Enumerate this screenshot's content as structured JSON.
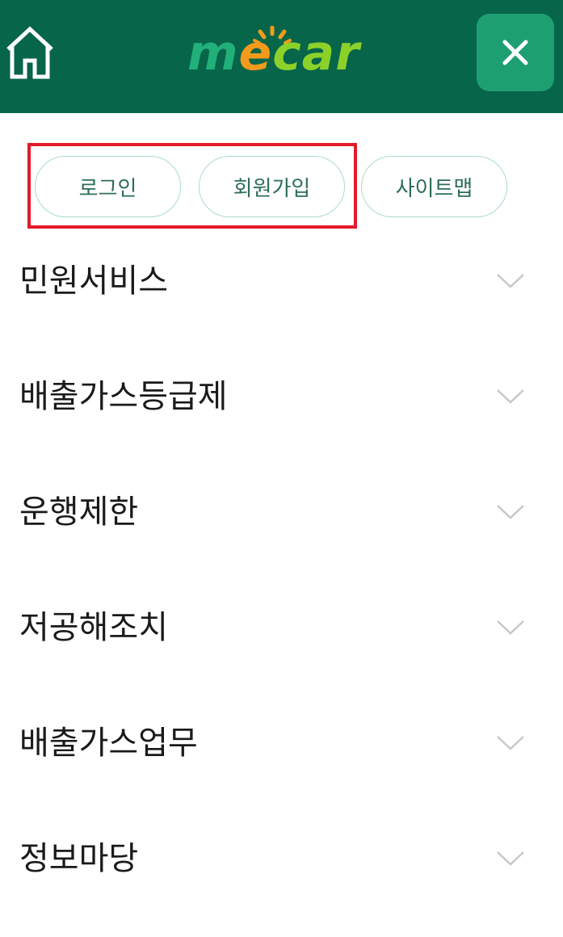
{
  "header": {
    "home_icon": "home-icon",
    "logo": {
      "text_m": "m",
      "text_e": "e",
      "text_car": "car",
      "colors": {
        "m": "#22b07a",
        "e": "#f39a1c",
        "car": "#8cd12a"
      }
    },
    "close_icon": "close-icon",
    "background": "#07654a",
    "close_background": "#1e9f72"
  },
  "auth": {
    "login_label": "로그인",
    "join_label": "회원가입",
    "sitemap_label": "사이트맵",
    "highlight_color": "#e21b2a"
  },
  "menu": {
    "items": [
      {
        "label": "민원서비스"
      },
      {
        "label": "배출가스등급제"
      },
      {
        "label": "운행제한"
      },
      {
        "label": "저공해조치"
      },
      {
        "label": "배출가스업무"
      },
      {
        "label": "정보마당"
      }
    ],
    "chevron_icon": "chevron-down-icon"
  }
}
